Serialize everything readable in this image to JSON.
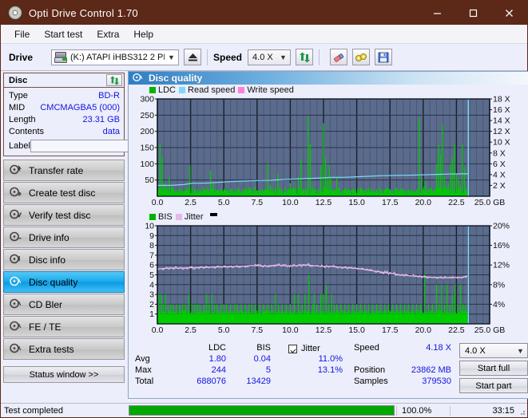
{
  "window": {
    "title": "Opti Drive Control 1.70",
    "icon": "disc-icon",
    "minimize": "minimize-icon",
    "maximize": "maximize-icon",
    "close": "close-icon"
  },
  "menu": {
    "items": [
      "File",
      "Start test",
      "Extra",
      "Help"
    ]
  },
  "toolbar": {
    "drive_label": "Drive",
    "drive_value": "(K:)  ATAPI iHBS312   2 PL17",
    "eject_icon": "eject-icon",
    "speed_label": "Speed",
    "speed_value": "4.0 X",
    "refresh_icon": "refresh-icon",
    "erase_icon": "eraser-icon",
    "tools_icon": "glasses-icon",
    "save_icon": "save-icon"
  },
  "disc": {
    "header": "Disc",
    "refresh_icon": "refresh-icon",
    "rows": [
      {
        "key": "Type",
        "value": "BD-R"
      },
      {
        "key": "MID",
        "value": "CMCMAGBA5 (000)"
      },
      {
        "key": "Length",
        "value": "23.31 GB"
      },
      {
        "key": "Contents",
        "value": "data"
      }
    ],
    "label_key": "Label",
    "label_value": "",
    "label_placeholder": "",
    "label_button_icon": "disc-icon"
  },
  "sidebar": {
    "items": [
      {
        "label": "Transfer rate",
        "icon": "disc-speed-icon",
        "active": false
      },
      {
        "label": "Create test disc",
        "icon": "disc-write-icon",
        "active": false
      },
      {
        "label": "Verify test disc",
        "icon": "disc-check-icon",
        "active": false
      },
      {
        "label": "Drive info",
        "icon": "drive-info-icon",
        "active": false
      },
      {
        "label": "Disc info",
        "icon": "disc-info-icon",
        "active": false
      },
      {
        "label": "Disc quality",
        "icon": "disc-quality-icon",
        "active": true
      },
      {
        "label": "CD Bler",
        "icon": "disc-bler-icon",
        "active": false
      },
      {
        "label": "FE / TE",
        "icon": "disc-fete-icon",
        "active": false
      },
      {
        "label": "Extra tests",
        "icon": "disc-extra-icon",
        "active": false
      }
    ],
    "status_window": "Status window >>"
  },
  "panel": {
    "title": "Disc quality",
    "title_icon": "disc-quality-icon"
  },
  "results": {
    "col_ldc": "LDC",
    "col_bis": "BIS",
    "jitter_label": "Jitter",
    "jitter_checked": true,
    "rows": [
      {
        "name": "Avg",
        "ldc": "1.80",
        "bis": "0.04",
        "jitter": "11.0%"
      },
      {
        "name": "Max",
        "ldc": "244",
        "bis": "5",
        "jitter": "13.1%"
      },
      {
        "name": "Total",
        "ldc": "688076",
        "bis": "13429",
        "jitter": ""
      }
    ],
    "speed_key": "Speed",
    "speed_value": "4.18 X",
    "position_key": "Position",
    "position_value": "23862 MB",
    "samples_key": "Samples",
    "samples_value": "379530",
    "speed_select": "4.0 X",
    "start_full": "Start full",
    "start_part": "Start part"
  },
  "statusbar": {
    "text": "Test completed",
    "percent": "100.0%",
    "progress": 100,
    "time": "33:15"
  },
  "colors": {
    "titlebar": "#5c2817",
    "accent": "#1414e0",
    "ldc": "#00cc00",
    "bis": "#00cc00",
    "read_speed": "#7fd8f7",
    "write_speed": "#ff7fe0",
    "jitter": "#e6b8e6",
    "plot_bg": "#5a6b8c",
    "progress": "#00a800"
  },
  "chart_data": [
    {
      "type": "line",
      "title": "LDC / Read speed",
      "xlabel": "GB",
      "ylabel": "",
      "xlim": [
        0,
        25
      ],
      "ylim": [
        0,
        300
      ],
      "y2lim": [
        0,
        18
      ],
      "grid": true,
      "legend_position": "top-left",
      "xticks": [
        "0.0",
        "2.5",
        "5.0",
        "7.5",
        "10.0",
        "12.5",
        "15.0",
        "17.5",
        "20.0",
        "22.5",
        "25.0 GB"
      ],
      "yticks": [
        50,
        100,
        150,
        200,
        250,
        300
      ],
      "y2ticks": [
        "2 X",
        "4 X",
        "6 X",
        "8 X",
        "10 X",
        "12 X",
        "14 X",
        "16 X",
        "18 X"
      ],
      "legend": [
        {
          "name": "LDC",
          "color": "#00cc00"
        },
        {
          "name": "Read speed",
          "color": "#7fd8f7"
        },
        {
          "name": "Write speed",
          "color": "#ff7fe0"
        }
      ],
      "series": [
        {
          "name": "LDC",
          "type": "impulse",
          "color": "#00cc00",
          "x": [
            0.05,
            0.2,
            0.35,
            0.5,
            0.62,
            0.75,
            0.9,
            1.05,
            1.2,
            1.4,
            1.6,
            1.8,
            2.0,
            2.2,
            2.45,
            2.6,
            2.8,
            3.0,
            3.2,
            3.45,
            3.6,
            3.8,
            4.0,
            4.2,
            4.35,
            4.5,
            4.7,
            4.9,
            5.1,
            5.3,
            5.5,
            5.7,
            5.9,
            6.1,
            6.3,
            6.5,
            6.7,
            6.9,
            7.1,
            7.3,
            7.5,
            7.7,
            7.9,
            8.1,
            8.3,
            8.5,
            8.7,
            8.9,
            9.05,
            9.2,
            9.4,
            9.6,
            9.8,
            10.0,
            10.2,
            10.4,
            10.6,
            10.8,
            11.0,
            11.2,
            11.35,
            11.5,
            11.65,
            11.8,
            11.95,
            12.1,
            12.3,
            12.5,
            12.65,
            12.8,
            12.95,
            13.05,
            13.2,
            13.35,
            13.5,
            13.7,
            13.9,
            14.1,
            14.3,
            14.5,
            14.7,
            14.9,
            15.1,
            15.3,
            15.5,
            15.7,
            15.9,
            16.1,
            16.3,
            16.5,
            16.7,
            16.9,
            17.1,
            17.3,
            17.5,
            17.7,
            17.9,
            18.1,
            18.3,
            18.5,
            18.7,
            18.9,
            19.1,
            19.3,
            19.5,
            19.7,
            19.9,
            20.05,
            20.2,
            20.4,
            20.6,
            20.8,
            21.0,
            21.15,
            21.3,
            21.45,
            21.6,
            21.75,
            21.9,
            22.05,
            22.2,
            22.35,
            22.5,
            22.65,
            22.8,
            22.95,
            23.1,
            23.2
          ],
          "values": [
            18,
            160,
            120,
            40,
            35,
            25,
            60,
            30,
            20,
            18,
            22,
            20,
            15,
            18,
            95,
            30,
            25,
            20,
            18,
            30,
            18,
            16,
            80,
            40,
            22,
            18,
            16,
            18,
            20,
            18,
            22,
            18,
            20,
            18,
            16,
            18,
            22,
            20,
            18,
            30,
            16,
            18,
            22,
            20,
            100,
            35,
            18,
            22,
            70,
            30,
            18,
            25,
            20,
            40,
            22,
            18,
            60,
            115,
            20,
            18,
            245,
            160,
            30,
            22,
            20,
            18,
            95,
            225,
            120,
            60,
            95,
            55,
            18,
            22,
            60,
            25,
            18,
            22,
            20,
            18,
            22,
            20,
            18,
            25,
            20,
            18,
            22,
            18,
            20,
            22,
            18,
            20,
            18,
            22,
            20,
            18,
            22,
            18,
            20,
            22,
            18,
            20,
            22,
            18,
            20,
            240,
            60,
            30,
            45,
            22,
            20,
            18,
            100,
            160,
            130,
            220,
            60,
            30,
            40,
            100,
            120,
            160,
            70,
            55,
            30,
            160,
            90,
            22
          ]
        },
        {
          "name": "Read speed",
          "type": "line",
          "color": "#7fd8f7",
          "axis": "y2",
          "x": [
            0.0,
            1.0,
            2.0,
            2.6,
            3.5,
            4.5,
            5.5,
            6.5,
            7.5,
            8.5,
            9.5,
            10.5,
            11.5,
            12.5,
            13.0,
            14.0,
            15.0,
            16.0,
            17.0,
            18.0,
            19.0,
            20.0,
            21.0,
            22.0,
            23.0,
            23.4,
            23.4
          ],
          "values": [
            2.0,
            2.0,
            2.15,
            2.4,
            2.4,
            2.55,
            2.7,
            2.8,
            2.9,
            2.95,
            3.1,
            3.2,
            3.3,
            3.4,
            3.5,
            3.5,
            3.6,
            3.7,
            3.8,
            3.85,
            3.9,
            3.95,
            4.05,
            4.1,
            4.15,
            4.15,
            18.0
          ]
        }
      ]
    },
    {
      "type": "line",
      "title": "BIS / Jitter",
      "xlabel": "GB",
      "ylabel": "",
      "xlim": [
        0,
        25
      ],
      "ylim": [
        0,
        10
      ],
      "y2lim": [
        0,
        20
      ],
      "grid": true,
      "legend_position": "top-left",
      "xticks": [
        "0.0",
        "2.5",
        "5.0",
        "7.5",
        "10.0",
        "12.5",
        "15.0",
        "17.5",
        "20.0",
        "22.5",
        "25.0 GB"
      ],
      "yticks": [
        1,
        2,
        3,
        4,
        5,
        6,
        7,
        8,
        9,
        10
      ],
      "y2ticks": [
        "4%",
        "8%",
        "12%",
        "16%",
        "20%"
      ],
      "legend": [
        {
          "name": "BIS",
          "color": "#00cc00"
        },
        {
          "name": "Jitter",
          "color": "#e6b8e6"
        }
      ],
      "series": [
        {
          "name": "BIS",
          "type": "impulse",
          "color": "#00cc00",
          "baseline": 1,
          "x": [
            0.1,
            0.3,
            0.45,
            0.6,
            0.8,
            1.0,
            1.2,
            1.45,
            1.7,
            1.9,
            2.1,
            2.35,
            2.6,
            2.8,
            3.0,
            3.2,
            3.5,
            3.7,
            3.9,
            4.1,
            4.3,
            4.5,
            4.8,
            5.0,
            5.2,
            5.5,
            5.8,
            6.0,
            6.3,
            6.6,
            6.9,
            7.1,
            7.4,
            7.7,
            8.0,
            8.3,
            8.6,
            8.9,
            9.1,
            9.4,
            9.7,
            10.0,
            10.3,
            10.6,
            10.9,
            11.1,
            11.4,
            11.7,
            11.8,
            12.0,
            12.3,
            12.5,
            12.7,
            12.9,
            13.1,
            13.3,
            13.5,
            13.8,
            14.1,
            14.4,
            14.7,
            15.0,
            15.3,
            15.6,
            15.9,
            16.2,
            16.5,
            16.8,
            17.1,
            17.4,
            17.7,
            18.0,
            18.3,
            18.6,
            18.9,
            19.2,
            19.5,
            19.8,
            20.1,
            20.4,
            20.7,
            21.0,
            21.2,
            21.4,
            21.6,
            21.8,
            22.0,
            22.2,
            22.4,
            22.6,
            22.8,
            23.0,
            23.2
          ],
          "values": [
            3,
            3,
            2,
            3,
            2,
            2,
            2,
            2,
            2,
            2,
            2,
            3,
            2,
            2,
            2,
            2,
            2,
            3,
            2,
            3,
            2,
            2,
            2,
            2,
            2,
            2,
            2,
            2,
            2,
            2,
            2,
            2,
            2,
            2,
            2,
            2,
            2,
            3,
            2,
            2,
            2,
            2,
            3,
            3,
            2,
            3,
            5,
            2,
            3,
            2,
            3,
            3,
            4,
            2,
            3,
            2,
            2,
            2,
            2,
            2,
            2,
            2,
            2,
            2,
            2,
            2,
            2,
            2,
            2,
            2,
            2,
            2,
            2,
            2,
            2,
            2,
            2,
            2,
            5,
            2,
            2,
            4,
            2,
            4,
            2,
            4,
            2,
            3,
            4,
            2,
            4,
            2,
            2
          ]
        },
        {
          "name": "Jitter",
          "type": "line",
          "color": "#e6b8e6",
          "axis": "y2",
          "x": [
            0.0,
            0.5,
            1.0,
            1.5,
            2.0,
            2.5,
            3.0,
            3.5,
            4.0,
            4.5,
            5.0,
            5.5,
            6.0,
            6.5,
            7.0,
            7.5,
            8.0,
            8.5,
            9.0,
            9.5,
            10.0,
            10.5,
            11.0,
            11.5,
            12.0,
            12.5,
            13.0,
            13.5,
            14.0,
            14.5,
            15.0,
            15.5,
            16.0,
            16.5,
            17.0,
            17.5,
            18.0,
            18.5,
            19.0,
            19.5,
            20.0,
            20.5,
            21.0,
            21.5,
            22.0,
            22.5,
            23.0,
            23.3
          ],
          "values": [
            11.2,
            11.3,
            11.4,
            11.35,
            11.4,
            11.45,
            11.5,
            11.5,
            11.55,
            11.6,
            11.6,
            11.65,
            11.7,
            11.75,
            11.9,
            11.85,
            11.8,
            11.9,
            12.0,
            11.85,
            11.8,
            11.9,
            12.05,
            11.95,
            11.8,
            11.7,
            11.75,
            11.6,
            11.5,
            11.4,
            11.3,
            11.1,
            10.9,
            10.7,
            10.5,
            10.3,
            10.1,
            9.9,
            9.8,
            9.7,
            9.6,
            9.5,
            9.45,
            9.4,
            9.4,
            9.45,
            9.5,
            9.8
          ]
        }
      ]
    }
  ]
}
